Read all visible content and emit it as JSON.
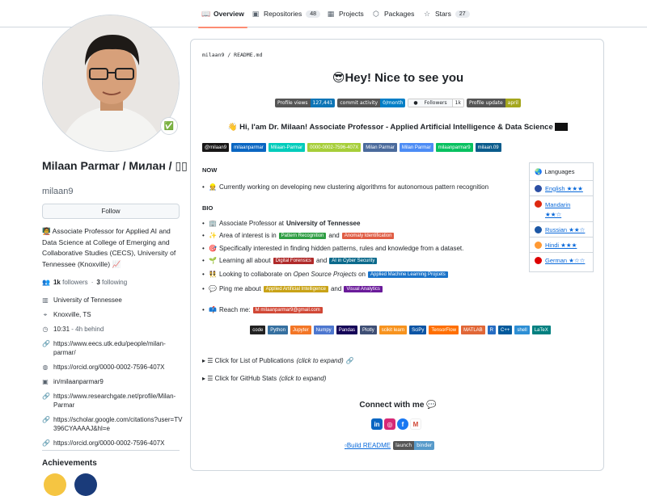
{
  "tabs": [
    {
      "label": "Overview",
      "icon": "book-icon"
    },
    {
      "label": "Repositories",
      "icon": "repo-icon",
      "count": "48"
    },
    {
      "label": "Projects",
      "icon": "table-icon"
    },
    {
      "label": "Packages",
      "icon": "package-icon"
    },
    {
      "label": "Stars",
      "icon": "star-icon",
      "count": "27"
    }
  ],
  "profile": {
    "full_name": "Milaan Parmar / Милан / ▯▯",
    "login": "milaan9",
    "follow_label": "Follow",
    "bio": "🧑‍🏫 Associate Professor for Applied AI and Data Science at College of Emerging and Collaborative Studies (CECS), University of Tennessee (Knoxville) 📈",
    "followers_count": "1k",
    "followers_label": "followers",
    "separator": "·",
    "following_count": "3",
    "following_label": "following",
    "organization": "University of Tennessee",
    "location": "Knoxville, TS",
    "time": "10:31",
    "time_note": "- 4h behind",
    "links": [
      "https://www.eecs.utk.edu/people/milan-parmar/",
      "https://orcid.org/0000-0002-7596-407X",
      "in/milaanparmar9",
      "https://www.researchgate.net/profile/Milan-Parmar",
      "https://scholar.google.com/citations?user=TV396CYAAAAJ&hl=e",
      "https://orcid.org/0000-0002-7596-407X"
    ],
    "achievements_label": "Achievements"
  },
  "readme": {
    "path_user": "milaan9",
    "path_sep": " / ",
    "path_file": "README.md",
    "title": "Hey! Nice to see you",
    "shields": [
      {
        "l": "Profile views",
        "r": "127,441",
        "rc": "#0e75b6"
      },
      {
        "l": "commit activity",
        "r": "0/month",
        "rc": "#007ec6"
      },
      {
        "l": "Followers",
        "r": "1k",
        "rc": "#eee"
      },
      {
        "l": "Profile update",
        "r": "april",
        "rc": "#a4a61d"
      }
    ],
    "intro": "👋 Hi, I'am Dr. Milaan! Associate Professor - Applied Artificial Intelligence & Data Science",
    "socials": [
      {
        "t": "@milaan9",
        "c": "#181717"
      },
      {
        "t": "milaanparmar",
        "c": "#0a66c2"
      },
      {
        "t": "Milaan-Parmar",
        "c": "#00ccbb"
      },
      {
        "t": "0000-0002-7596-407X",
        "c": "#a6ce39"
      },
      {
        "t": "Milan Parmar",
        "c": "#4285f4"
      },
      {
        "t": "Milan Parmar",
        "c": "#4c8cf5"
      },
      {
        "t": "milaanparmar9",
        "c": "#07c160"
      },
      {
        "t": "milaan.09",
        "c": "#0a5c8c"
      }
    ],
    "now_label": "NOW",
    "now_item": "Currently working on developing new clustering algorithms for autonomous pattern recognition",
    "bio_label": "BIO",
    "bio_items": {
      "b1_pre": "Associate Professor at ",
      "b1_bold": "University of Tennessee",
      "b2_pre": "Area of interest is in",
      "b2_tag1": "Pattern Recognition",
      "b2_and": "and",
      "b2_tag2": "Anomaly Identification",
      "b3": "Specifically interested in finding hidden patterns, rules and knowledge from a dataset.",
      "b4_pre": "Learning all about",
      "b4_tag1": "Digital Forensics",
      "b4_and": "and",
      "b4_tag2": "AI in Cyber Security",
      "b5_pre": "Looking to collaborate on ",
      "b5_em": "Open Source Projects",
      "b5_on": " on",
      "b5_tag": "Applied Machine Learning Projcets",
      "b6_pre": "Ping me about",
      "b6_tag1": "Applied Artificial Intelligence",
      "b6_and": "and",
      "b6_tag2": "Visual Analytics",
      "b7_pre": "Reach me:",
      "b7_tag": "milaanparmar9@gmail.com"
    },
    "languages_label": "Languages",
    "languages": [
      {
        "name": "English ★★★",
        "c": "#2b4ea3"
      },
      {
        "name": "Mandarin ★★☆",
        "c": "#de2910"
      },
      {
        "name": "Russian ★★☆",
        "c": "#1c57a5"
      },
      {
        "name": "Hindi ★★★",
        "c": "#ff9933"
      },
      {
        "name": "German ★☆☆",
        "c": "#dd0000"
      }
    ],
    "tech": [
      {
        "t": "code",
        "c": "#222"
      },
      {
        "t": "Python",
        "c": "#3670a0"
      },
      {
        "t": "Jupyter",
        "c": "#fa0f00"
      },
      {
        "t": "Numpy",
        "c": "#013243"
      },
      {
        "t": "Pandas",
        "c": "#150458"
      },
      {
        "t": "Plotly",
        "c": "#3f4f75"
      },
      {
        "t": "scikit learn",
        "c": "#f7931e"
      },
      {
        "t": "SciPy",
        "c": "#0c55a5"
      },
      {
        "t": "TensorFlow",
        "c": "#ff6f00"
      },
      {
        "t": "MATLAB",
        "c": "#e16737"
      },
      {
        "t": "R",
        "c": "#276dc3"
      },
      {
        "t": "C++",
        "c": "#00599c"
      },
      {
        "t": "shell",
        "c": "#4eaa25"
      },
      {
        "t": "LaTeX",
        "c": "#008080"
      }
    ],
    "pubs_prefix": "▸ ☰ Click for List of Publications",
    "pubs_em": "(click to expand)",
    "stats_prefix": "▸ ☰ Click for GitHub Stats",
    "stats_em": "(click to expand)",
    "connect_label": "Connect with me",
    "build_label": "Build README",
    "binder_l": "launch",
    "binder_r": "binder"
  }
}
